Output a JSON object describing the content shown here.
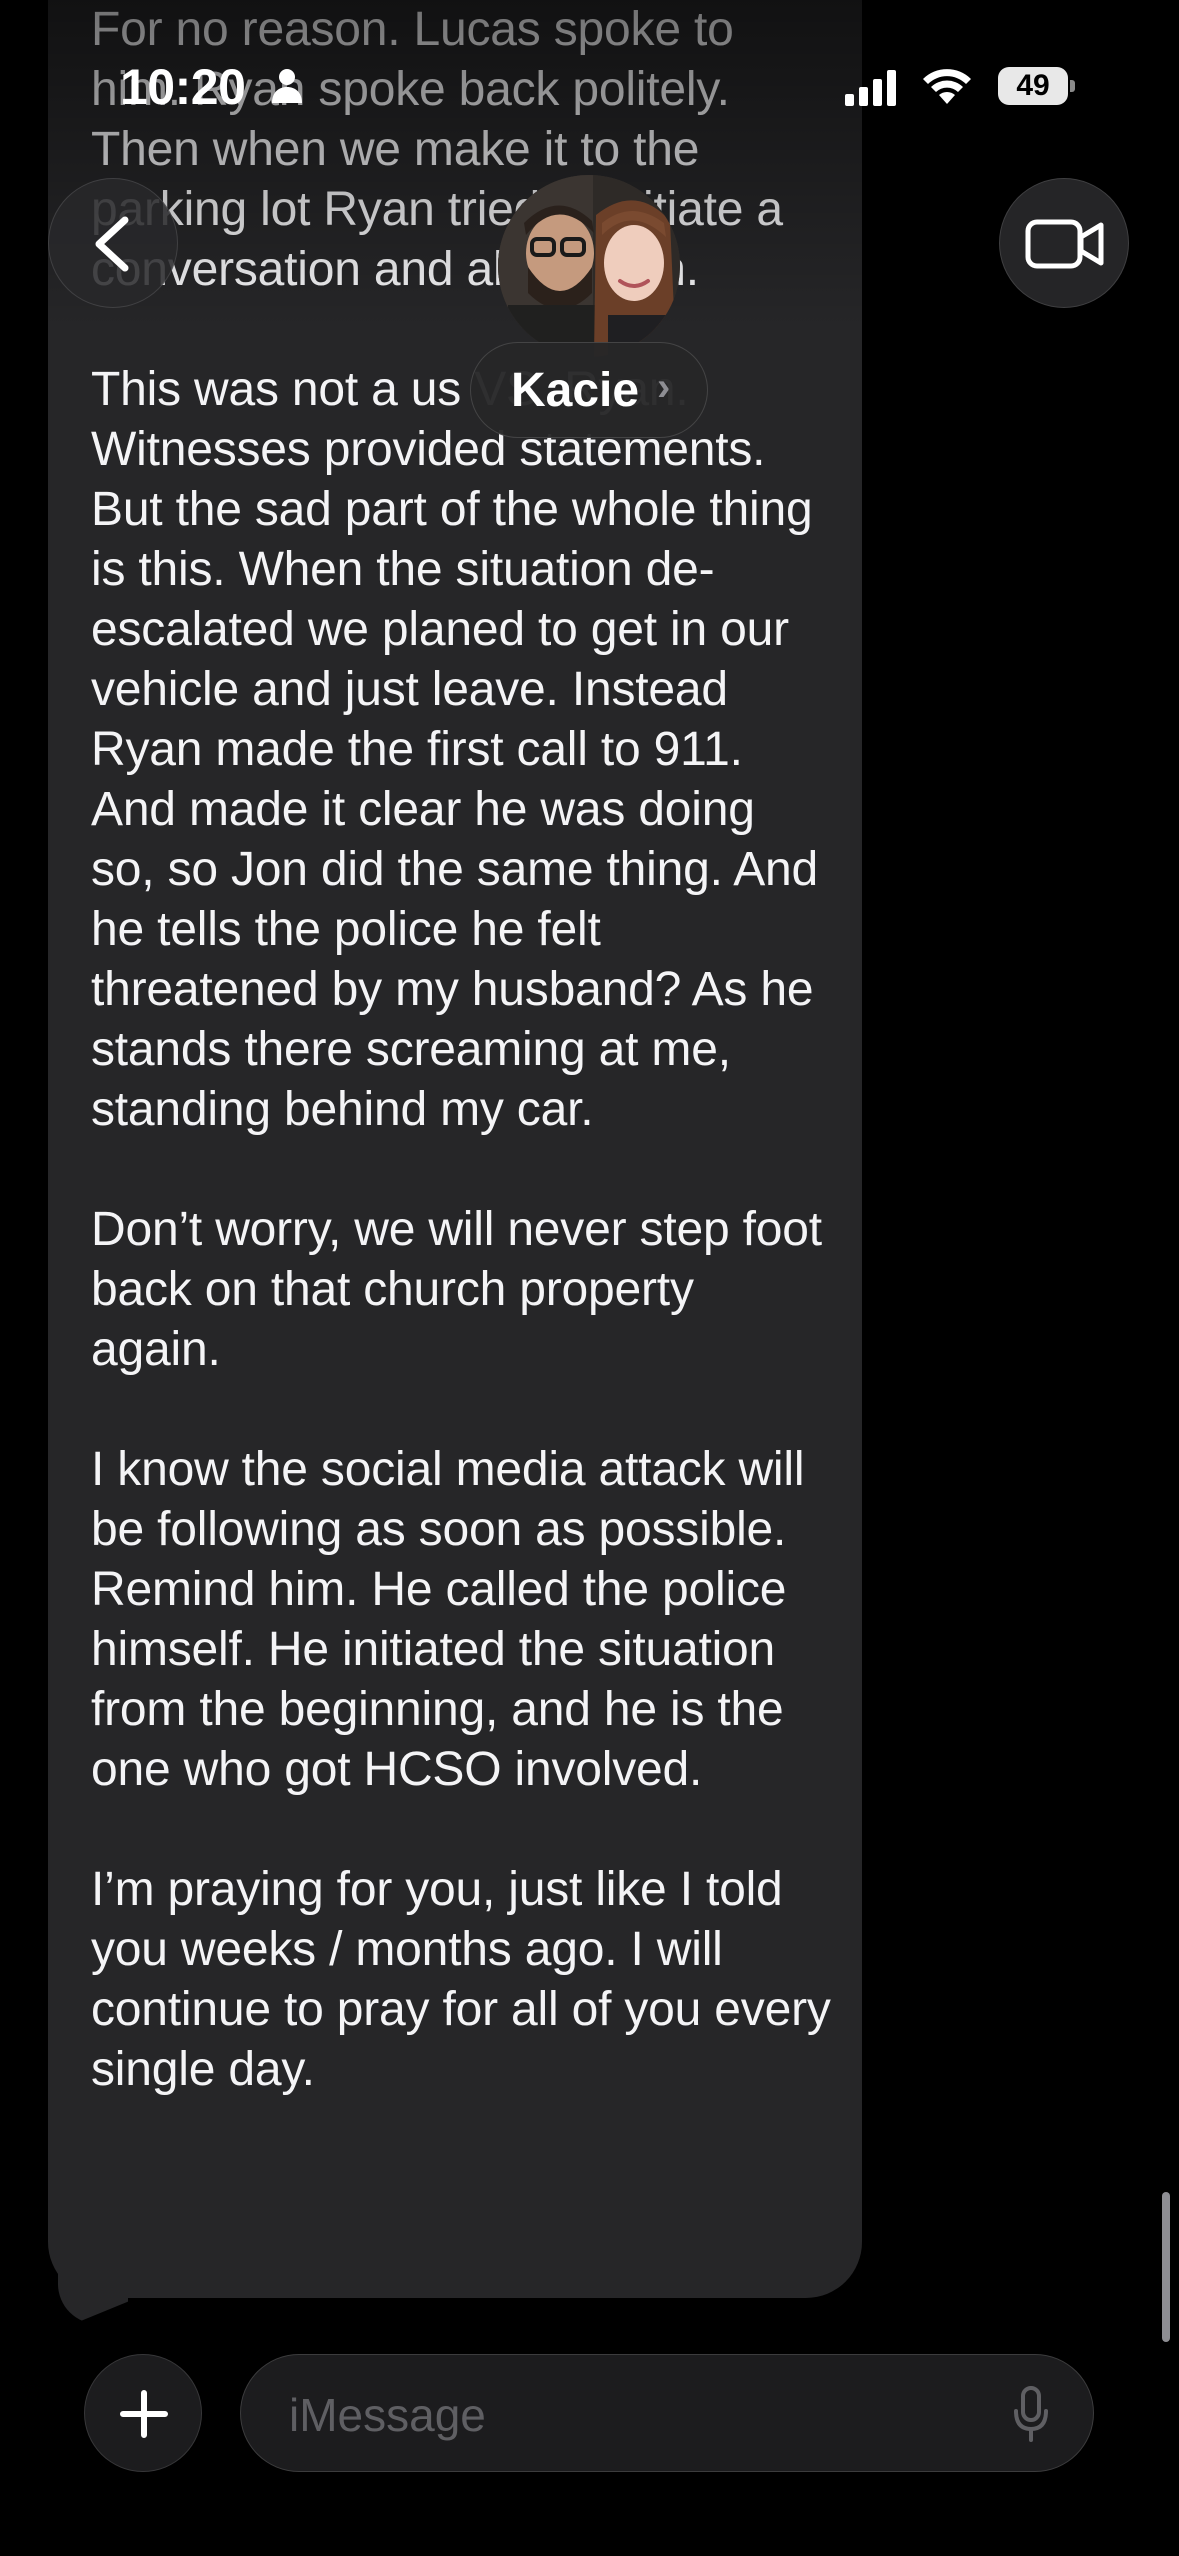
{
  "status_bar": {
    "time": "10:20",
    "battery": "49"
  },
  "header": {
    "contact_name": "Kacie",
    "chevron": "›",
    "icons": {
      "back": "chevron-left-icon",
      "video": "video-camera-icon",
      "avatar": "contact-avatar"
    }
  },
  "messages": [
    {
      "direction": "incoming",
      "paragraphs": [
        "For no reason. Lucas spoke to him. Ryan spoke back politely. Then when we make it to the parking lot Ryan tried to initiate a conversation and altercation.",
        "This was not a us VS. Ryan. Witnesses provided statements. But the sad part of the whole thing is this. When the situation de-escalated we planed to get in our vehicle and just leave. Instead Ryan made the first call to 911. And made it clear he was doing so, so Jon did the same thing. And he tells the police he felt threatened by my husband? As he stands there screaming at me, standing behind my car.",
        "Don’t worry, we will never step foot back on that church property again.",
        "I know the social media attack will be following as soon as possible. Remind him. He called the police himself. He initiated the situation from the beginning, and he is the one who got HCSO involved.",
        "I’m praying for you, just like I told you weeks / months ago. I will continue to pray for all of you every single day."
      ]
    }
  ],
  "composer": {
    "placeholder": "iMessage",
    "icons": {
      "add": "plus-icon",
      "mic": "microphone-icon"
    }
  },
  "colors": {
    "background": "#000000",
    "incoming_bubble": "#262628",
    "text": "#f4f4f6",
    "placeholder": "#5f5f63"
  }
}
